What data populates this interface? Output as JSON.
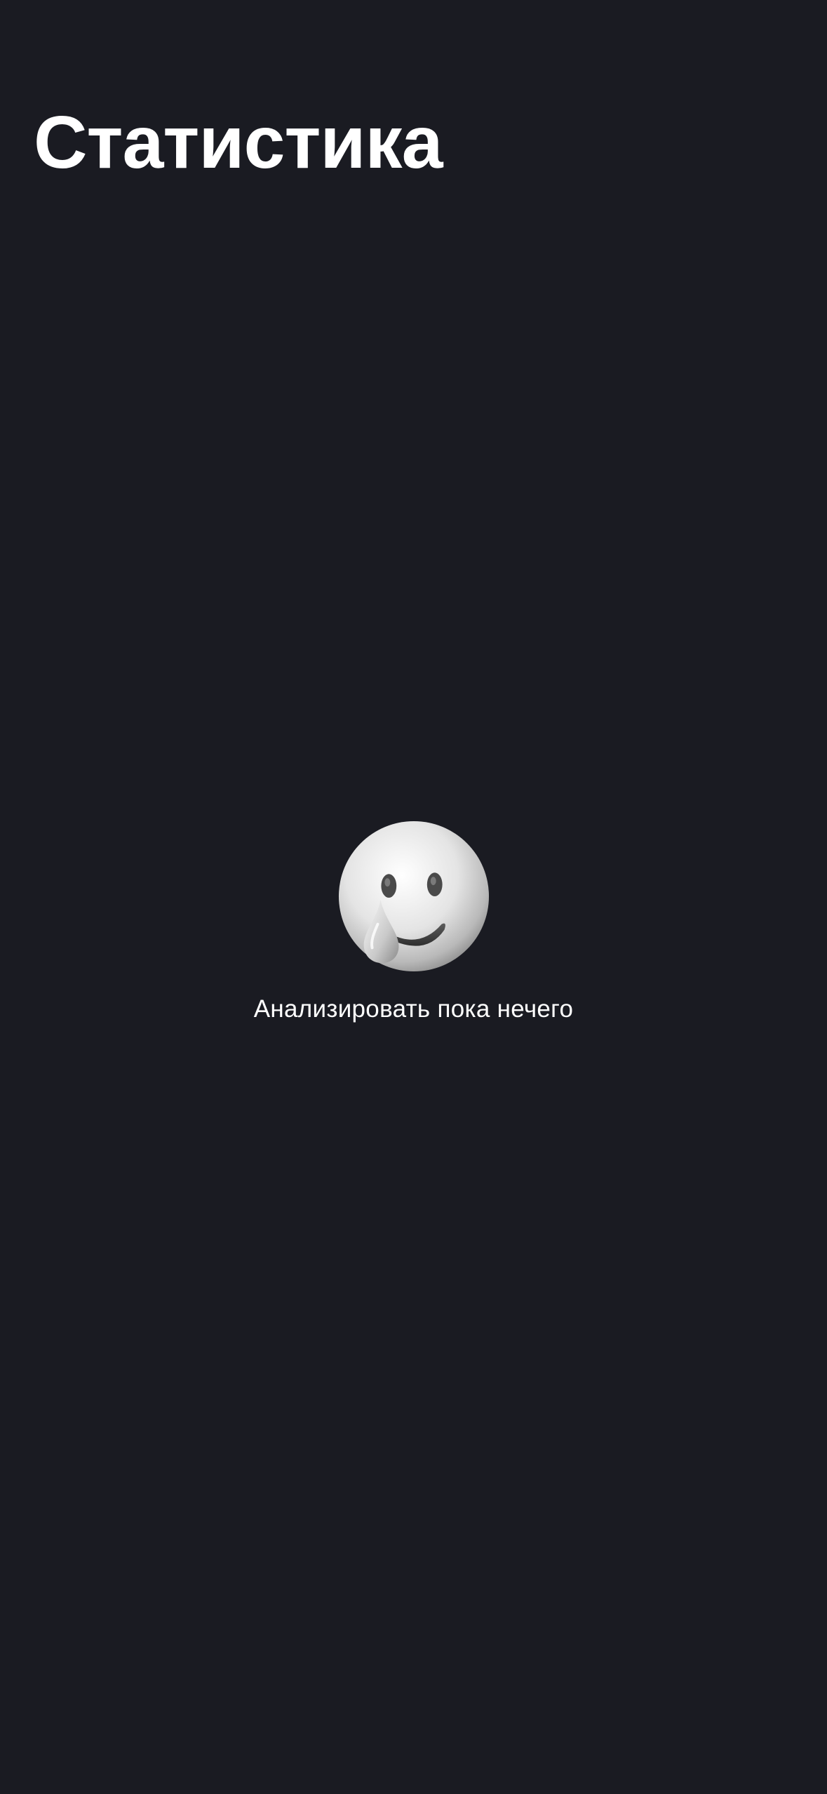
{
  "header": {
    "title": "Статистика"
  },
  "empty_state": {
    "icon": "smiling-face-with-tear-icon",
    "message": "Анализировать пока нечего"
  },
  "colors": {
    "background": "#1a1b22",
    "text": "#ffffff"
  }
}
